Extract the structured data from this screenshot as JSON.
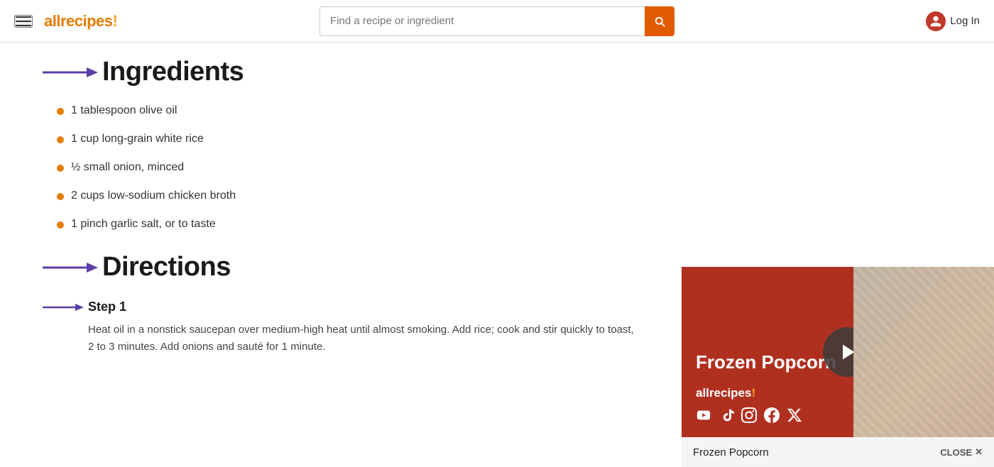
{
  "header": {
    "logo_text": "allrecipes",
    "logo_exclaim": "!",
    "search_placeholder": "Find a recipe or ingredient",
    "login_label": "Log In"
  },
  "ingredients": {
    "section_title": "Ingredients",
    "items": [
      "1 tablespoon olive oil",
      "1 cup long-grain white rice",
      "½ small onion, minced",
      "2 cups low-sodium chicken broth",
      "1 pinch garlic salt, or to taste"
    ]
  },
  "directions": {
    "section_title": "Directions",
    "steps": [
      {
        "label": "Step 1",
        "text": "Heat oil in a nonstick saucepan over medium-high heat until almost smoking. Add rice; cook and stir quickly to toast, 2 to 3 minutes. Add onions and sauté for 1 minute."
      }
    ]
  },
  "video_card": {
    "title": "Frozen Popcorn",
    "brand_name": "allrecipes",
    "brand_exclaim": "!",
    "bottom_title": "Frozen Popcorn",
    "close_label": "CLOSE"
  }
}
